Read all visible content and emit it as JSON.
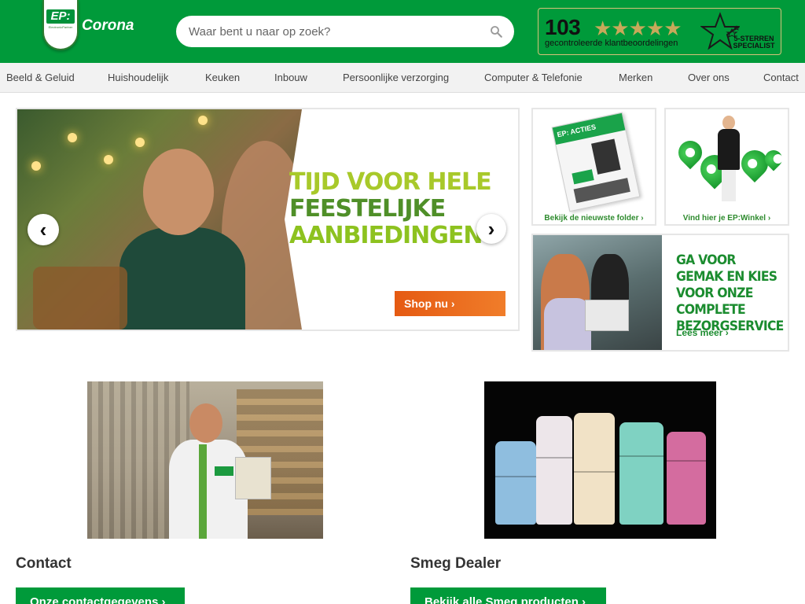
{
  "header": {
    "logo_text": "EP:",
    "logo_subtext": "ElectronicPartner",
    "store_name": "Corona",
    "search_placeholder": "Waar bent u naar op zoek?",
    "reviews": {
      "count": "103",
      "stars": "★★★★★",
      "label": "gecontroleerde klantbeoordelingen",
      "badge_line1": "5-STERREN",
      "badge_line2": "SPECIALIST"
    }
  },
  "nav": {
    "items": [
      "Beeld & Geluid",
      "Huishoudelijk",
      "Keuken",
      "Inbouw",
      "Persoonlijke verzorging",
      "Computer & Telefonie",
      "Merken",
      "Over ons",
      "Contact"
    ]
  },
  "hero": {
    "line1": "TIJD VOOR HELE",
    "line2": "FEESTELIJKE",
    "line3": "AANBIEDINGEN",
    "button": "Shop nu ›",
    "prev_icon": "‹",
    "next_icon": "›"
  },
  "tiles": {
    "folder_badge": "EP: ACTIES",
    "folder_caption": "Bekijk de nieuwste folder ›",
    "store_caption": "Vind hier je EP:Winkel ›",
    "delivery_text": "GA VOOR GEMAK EN KIES VOOR ONZE COMPLETE BEZORGSERVICE",
    "delivery_link": "Lees meer ›"
  },
  "cards": {
    "contact_title": "Contact",
    "contact_button": "Onze contactgegevens ›",
    "smeg_title": "Smeg Dealer",
    "smeg_button": "Bekijk alle Smeg producten ›"
  },
  "colors": {
    "brand_green": "#009a3a",
    "accent_orange": "#f07d2a",
    "star_gold": "#c7a95a"
  }
}
